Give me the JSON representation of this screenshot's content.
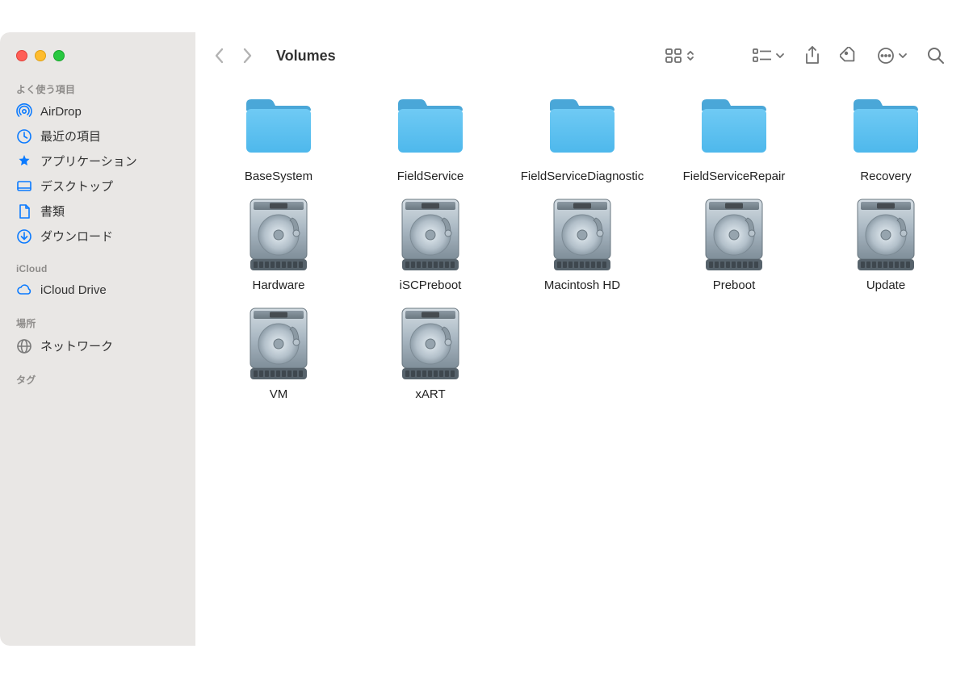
{
  "traffic": {
    "close": "close",
    "minimize": "minimize",
    "zoom": "zoom"
  },
  "title": "Volumes",
  "sidebar": {
    "favorites_head": "よく使う項目",
    "icloud_head": "iCloud",
    "locations_head": "場所",
    "tags_head": "タグ",
    "items_fav": [
      {
        "label": "AirDrop",
        "icon": "airdrop"
      },
      {
        "label": "最近の項目",
        "icon": "clock"
      },
      {
        "label": "アプリケーション",
        "icon": "app"
      },
      {
        "label": "デスクトップ",
        "icon": "desktop"
      },
      {
        "label": "書類",
        "icon": "doc"
      },
      {
        "label": "ダウンロード",
        "icon": "download"
      }
    ],
    "items_icloud": [
      {
        "label": "iCloud Drive",
        "icon": "cloud"
      }
    ],
    "items_loc": [
      {
        "label": "ネットワーク",
        "icon": "globe"
      }
    ]
  },
  "content": {
    "items": [
      {
        "label": "BaseSystem",
        "kind": "folder"
      },
      {
        "label": "FieldService",
        "kind": "folder"
      },
      {
        "label": "FieldServiceDiagnostic",
        "kind": "folder"
      },
      {
        "label": "FieldServiceRepair",
        "kind": "folder"
      },
      {
        "label": "Recovery",
        "kind": "folder"
      },
      {
        "label": "Hardware",
        "kind": "disk"
      },
      {
        "label": "iSCPreboot",
        "kind": "disk"
      },
      {
        "label": "Macintosh HD",
        "kind": "disk"
      },
      {
        "label": "Preboot",
        "kind": "disk"
      },
      {
        "label": "Update",
        "kind": "disk"
      },
      {
        "label": "VM",
        "kind": "disk"
      },
      {
        "label": "xART",
        "kind": "disk"
      }
    ]
  }
}
